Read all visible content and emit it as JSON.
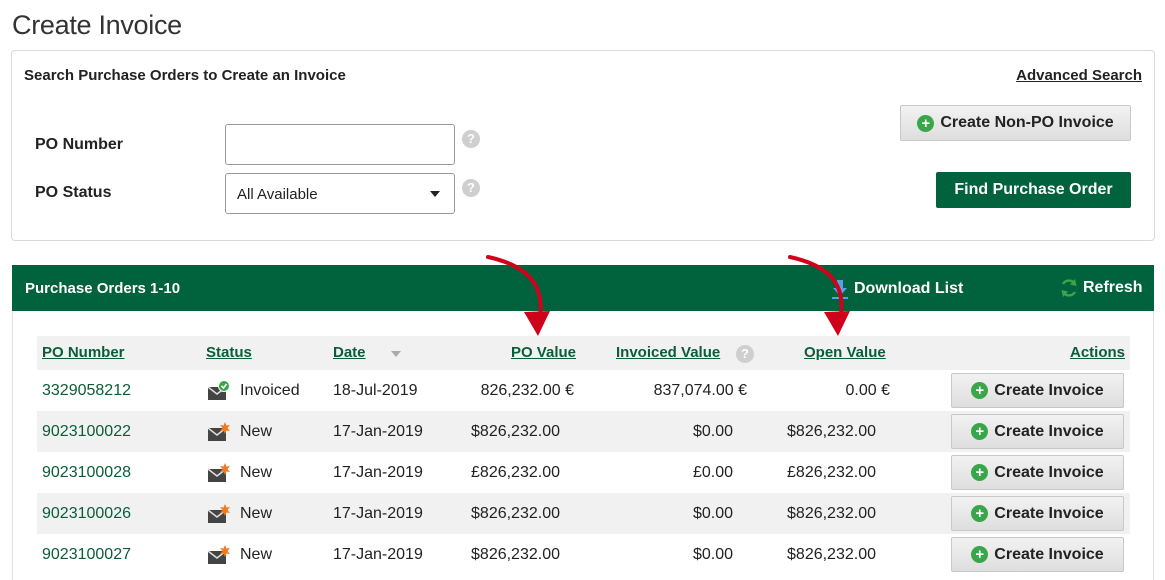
{
  "page": {
    "title": "Create Invoice"
  },
  "search": {
    "heading": "Search Purchase Orders to Create an Invoice",
    "advanced_link": "Advanced Search",
    "po_number_label": "PO Number",
    "po_number_value": "",
    "po_status_label": "PO Status",
    "po_status_value": "All Available",
    "help_glyph": "?",
    "create_non_po_button": "Create Non-PO Invoice",
    "find_button": "Find Purchase Order"
  },
  "results": {
    "title": "Purchase Orders 1-10",
    "download_label": "Download List",
    "refresh_label": "Refresh",
    "columns": {
      "po_number": "PO Number",
      "status": "Status",
      "date": "Date",
      "po_value": "PO Value",
      "invoiced_value": "Invoiced Value",
      "open_value": "Open Value",
      "actions": "Actions"
    },
    "rows": [
      {
        "po_number": "3329058212",
        "status": "Invoiced",
        "status_icon": "envelope-check-icon",
        "date": "18-Jul-2019",
        "po_value": "826,232.00 €",
        "invoiced_value": "837,074.00 €",
        "open_value": "0.00 €",
        "action": "Create Invoice"
      },
      {
        "po_number": "9023100022",
        "status": "New",
        "status_icon": "envelope-new-icon",
        "date": "17-Jan-2019",
        "po_value": "$826,232.00",
        "invoiced_value": "$0.00",
        "open_value": "$826,232.00",
        "action": "Create Invoice"
      },
      {
        "po_number": "9023100028",
        "status": "New",
        "status_icon": "envelope-new-icon",
        "date": "17-Jan-2019",
        "po_value": "£826,232.00",
        "invoiced_value": "£0.00",
        "open_value": "£826,232.00",
        "action": "Create Invoice"
      },
      {
        "po_number": "9023100026",
        "status": "New",
        "status_icon": "envelope-new-icon",
        "date": "17-Jan-2019",
        "po_value": "$826,232.00",
        "invoiced_value": "$0.00",
        "open_value": "$826,232.00",
        "action": "Create Invoice"
      },
      {
        "po_number": "9023100027",
        "status": "New",
        "status_icon": "envelope-new-icon",
        "date": "17-Jan-2019",
        "po_value": "$826,232.00",
        "invoiced_value": "$0.00",
        "open_value": "$826,232.00",
        "action": "Create Invoice"
      }
    ]
  },
  "colors": {
    "brand_green": "#00633e",
    "link_green": "#0b5d37",
    "plus_green": "#3aa64a",
    "annotation_red": "#d0021b"
  }
}
